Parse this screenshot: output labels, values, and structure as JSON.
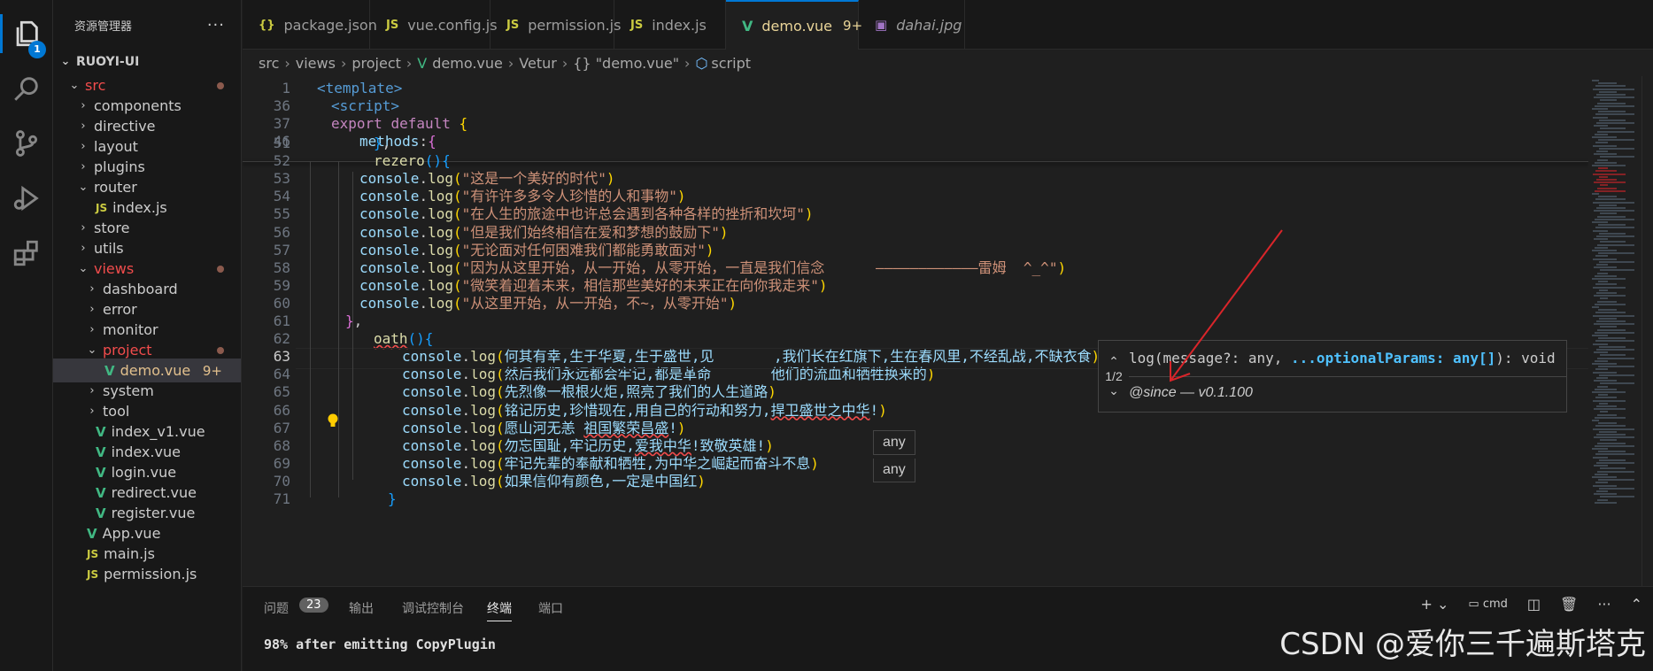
{
  "activity_bar": {
    "items": [
      {
        "name": "explorer-icon",
        "badge": "1"
      },
      {
        "name": "search-icon"
      },
      {
        "name": "source-control-icon"
      },
      {
        "name": "run-debug-icon"
      },
      {
        "name": "extensions-icon"
      }
    ]
  },
  "sidebar": {
    "title": "资源管理器",
    "more": "···",
    "project": "RUOYI-UI",
    "tree": [
      {
        "label": "src",
        "type": "folder-open",
        "depth": 1,
        "color": "red",
        "dot": true
      },
      {
        "label": "components",
        "type": "folder",
        "depth": 2
      },
      {
        "label": "directive",
        "type": "folder",
        "depth": 2
      },
      {
        "label": "layout",
        "type": "folder",
        "depth": 2
      },
      {
        "label": "plugins",
        "type": "folder",
        "depth": 2
      },
      {
        "label": "router",
        "type": "folder-open",
        "depth": 2
      },
      {
        "label": "index.js",
        "type": "js",
        "depth": 3
      },
      {
        "label": "store",
        "type": "folder",
        "depth": 2
      },
      {
        "label": "utils",
        "type": "folder",
        "depth": 2
      },
      {
        "label": "views",
        "type": "folder-open",
        "depth": 2,
        "color": "red",
        "dot": true
      },
      {
        "label": "dashboard",
        "type": "folder",
        "depth": 3
      },
      {
        "label": "error",
        "type": "folder",
        "depth": 3
      },
      {
        "label": "monitor",
        "type": "folder",
        "depth": 3
      },
      {
        "label": "project",
        "type": "folder-open",
        "depth": 3,
        "color": "red",
        "dot": true
      },
      {
        "label": "demo.vue",
        "type": "vue",
        "depth": 4,
        "color": "mod",
        "count": "9+",
        "selected": true
      },
      {
        "label": "system",
        "type": "folder",
        "depth": 3
      },
      {
        "label": "tool",
        "type": "folder",
        "depth": 3
      },
      {
        "label": "index_v1.vue",
        "type": "vue",
        "depth": 3
      },
      {
        "label": "index.vue",
        "type": "vue",
        "depth": 3
      },
      {
        "label": "login.vue",
        "type": "vue",
        "depth": 3
      },
      {
        "label": "redirect.vue",
        "type": "vue",
        "depth": 3
      },
      {
        "label": "register.vue",
        "type": "vue",
        "depth": 3
      },
      {
        "label": "App.vue",
        "type": "vue",
        "depth": 2
      },
      {
        "label": "main.js",
        "type": "js",
        "depth": 2
      },
      {
        "label": "permission.js",
        "type": "js",
        "depth": 2
      }
    ]
  },
  "tabs": [
    {
      "label": "package.json",
      "icon": "{}",
      "kind": "json"
    },
    {
      "label": "vue.config.js",
      "icon": "JS",
      "kind": "js"
    },
    {
      "label": "permission.js",
      "icon": "JS",
      "kind": "js"
    },
    {
      "label": "index.js",
      "icon": "JS",
      "kind": "js"
    },
    {
      "label": "demo.vue",
      "icon": "V",
      "kind": "vue",
      "count": "9+",
      "active": true,
      "unsaved": true
    },
    {
      "label": "dahai.jpg",
      "icon": "▣",
      "kind": "img",
      "italic": true
    }
  ],
  "breadcrumb": {
    "parts": [
      "src",
      "views",
      "project",
      "demo.vue",
      "Vetur",
      "{} \"demo.vue\"",
      "script"
    ]
  },
  "editor": {
    "lines": [
      {
        "n": "1",
        "indent": 0,
        "html": "<span class='tok-tag'>&lt;template&gt;</span>"
      },
      {
        "n": "36",
        "indent": 1,
        "html": "<span class='tok-tag'>&lt;script&gt;</span>"
      },
      {
        "n": "37",
        "indent": 1,
        "html": "<span class='tok-kw'>export</span> <span class='tok-kw'>default</span> <span class='tok-br1'>{</span>"
      },
      {
        "n": "46",
        "indent": 3,
        "html": "<span class='tok-plain'>methods</span>:<span class='tok-br2'>{</span>"
      },
      {
        "n": "51",
        "indent": 4,
        "html": "<span class='tok-br3'>}</span>,"
      },
      {
        "n": "52",
        "indent": 4,
        "html": "<span class='tok-fn'>rezero</span><span class='tok-br3'>(){</span>"
      },
      {
        "n": "53",
        "indent": 3,
        "html": "<span class='tok-var'>console</span>.<span class='tok-fn'>log</span><span class='tok-br1'>(</span><span class='tok-str'>\"这是一个美好的时代\"</span><span class='tok-br1'>)</span>"
      },
      {
        "n": "54",
        "indent": 3,
        "html": "<span class='tok-var'>console</span>.<span class='tok-fn'>log</span><span class='tok-br1'>(</span><span class='tok-str'>\"有许许多多令人珍惜的人和事物\"</span><span class='tok-br1'>)</span>"
      },
      {
        "n": "55",
        "indent": 3,
        "html": "<span class='tok-var'>console</span>.<span class='tok-fn'>log</span><span class='tok-br1'>(</span><span class='tok-str'>\"在人生的旅途中也许总会遇到各种各样的挫折和坎坷\"</span><span class='tok-br1'>)</span>"
      },
      {
        "n": "56",
        "indent": 3,
        "html": "<span class='tok-var'>console</span>.<span class='tok-fn'>log</span><span class='tok-br1'>(</span><span class='tok-str'>\"但是我们始终相信在爱和梦想的鼓励下\"</span><span class='tok-br1'>)</span>"
      },
      {
        "n": "57",
        "indent": 3,
        "html": "<span class='tok-var'>console</span>.<span class='tok-fn'>log</span><span class='tok-br1'>(</span><span class='tok-str'>\"无论面对任何困难我们都能勇敢面对\"</span><span class='tok-br1'>)</span>"
      },
      {
        "n": "58",
        "indent": 3,
        "html": "<span class='tok-var'>console</span>.<span class='tok-fn'>log</span><span class='tok-br1'>(</span><span class='tok-str'>\"因为从这里开始，从一开始，从零开始，一直是我们信念      ————————————雷姆  ^_^\"</span><span class='tok-br1'>)</span>"
      },
      {
        "n": "59",
        "indent": 3,
        "html": "<span class='tok-var'>console</span>.<span class='tok-fn'>log</span><span class='tok-br1'>(</span><span class='tok-str'>\"微笑着迎着未来，相信那些美好的未来正在向你我走来\"</span><span class='tok-br1'>)</span>"
      },
      {
        "n": "60",
        "indent": 3,
        "html": "<span class='tok-var'>console</span>.<span class='tok-fn'>log</span><span class='tok-br1'>(</span><span class='tok-str'>\"从这里开始，从一开始，不~，从零开始\"</span><span class='tok-br1'>)</span>"
      },
      {
        "n": "61",
        "indent": 2,
        "html": "<span class='tok-br2'>}</span>,"
      },
      {
        "n": "62",
        "indent": 4,
        "html": "<span class='tok-fn squig'>oath</span><span class='tok-br3'>(){</span>"
      },
      {
        "n": "63",
        "indent": 6,
        "html": "<span class='tok-var'>console</span>.<span class='tok-fn'>log</span><span class='tok-br1'>(</span><span class='tok-cn'>何其有幸,生于华夏,生于盛世,见       ,我们长在红旗下,生在春风里,不经乱战,不缺衣食</span><span class='tok-br1'>)</span>",
        "current": true
      },
      {
        "n": "64",
        "indent": 6,
        "html": "<span class='tok-var'>console</span>.<span class='tok-fn'>log</span><span class='tok-br1'>(</span><span class='tok-cn'>然后我们永远都会牢记,都是革命       他们的流血和牺牲换来的</span><span class='tok-br1'>)</span>"
      },
      {
        "n": "65",
        "indent": 6,
        "html": "<span class='tok-var'>console</span>.<span class='tok-fn'>log</span><span class='tok-br1'>(</span><span class='tok-cn'>先烈像一根根火炬,照亮了我们的人生道路</span><span class='tok-br1'>)</span>"
      },
      {
        "n": "66",
        "indent": 6,
        "html": "<span class='tok-var'>console</span>.<span class='tok-fn'>log</span><span class='tok-br1'>(</span><span class='tok-cn'>铭记历史,珍惜现在,用自己的行动和努力,<span class='squig'>捍卫盛世之中华</span>!</span><span class='tok-br1'>)</span>"
      },
      {
        "n": "67",
        "indent": 6,
        "html": "<span class='tok-var'>console</span>.<span class='tok-fn'>log</span><span class='tok-br1'>(</span><span class='tok-cn'>愿山河无恙 <span class='squig'>祖国繁荣昌盛</span>!</span><span class='tok-br1'>)</span>"
      },
      {
        "n": "68",
        "indent": 6,
        "html": "<span class='tok-var'>console</span>.<span class='tok-fn'>log</span><span class='tok-br1'>(</span><span class='tok-cn'>勿忘国耻,牢记历史,<span class='squig'>爱我中华</span>!致敬英雄!</span><span class='tok-br1'>)</span>"
      },
      {
        "n": "69",
        "indent": 6,
        "html": "<span class='tok-var'>console</span>.<span class='tok-fn'>log</span><span class='tok-br1'>(</span><span class='tok-cn'>牢记先辈的奉献和牺牲,为中华之崛起而奋斗不息</span><span class='tok-br1'>)</span>"
      },
      {
        "n": "70",
        "indent": 6,
        "html": "<span class='tok-var'>console</span>.<span class='tok-fn'>log</span><span class='tok-br1'>(</span><span class='tok-cn'>如果信仰有颜色,一定是中国红</span><span class='tok-br1'>)</span>"
      },
      {
        "n": "71",
        "indent": 5,
        "html": "<span class='tok-br3'>}</span>"
      }
    ]
  },
  "hover": {
    "any_1": "any",
    "any_2": "any",
    "signature": {
      "nav_up": "^",
      "counter": "1/2",
      "nav_down": "v",
      "prefix": "log(message?: any, ",
      "active_param": "...optionalParams: any[]",
      "suffix": "): void",
      "doc": "@since — v0.1.100"
    }
  },
  "panel": {
    "tabs": [
      "问题",
      "输出",
      "调试控制台",
      "终端",
      "端口"
    ],
    "problems_count": "23",
    "active_tab": "终端",
    "tools": [
      "+",
      "cmd"
    ],
    "terminal_output": "98% after emitting CopyPlugin"
  },
  "watermark": "CSDN @爱你三千遍斯塔克",
  "colors": {
    "accent": "#0078d4",
    "modified": "#e2c08d",
    "error": "#f14c4c",
    "vue": "#41b883",
    "annotation_arrow": "#d9252a"
  }
}
